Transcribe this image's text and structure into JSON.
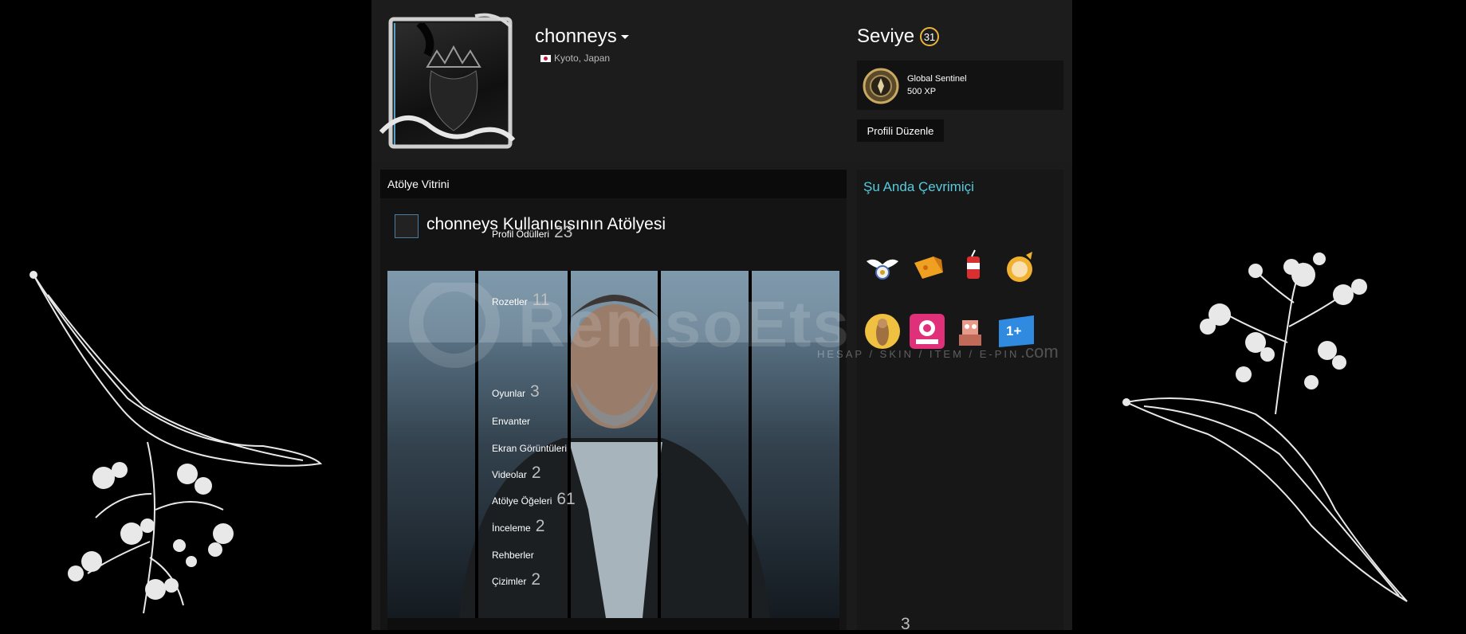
{
  "profile": {
    "persona_name": "chonneys",
    "location": "Kyoto, Japan",
    "level_label": "Seviye",
    "level_value": "31",
    "favorite_badge": {
      "name": "Global Sentinel",
      "xp": "500 XP"
    },
    "edit_button": "Profili Düzenle"
  },
  "showcase": {
    "header": "Atölye Vitrini",
    "workshop_title": "chonneys Kullanıcısının Atölyesi"
  },
  "status": {
    "online": "Şu Anda Çevrimiçi"
  },
  "sidebar": {
    "awards": {
      "label": "Profil Ödülleri",
      "count": "23"
    },
    "badges": {
      "label": "Rozetler",
      "count": "11",
      "extra_badge": "1+"
    },
    "items": [
      {
        "label": "Oyunlar",
        "count": "3"
      },
      {
        "label": "Envanter",
        "count": ""
      },
      {
        "label": "Ekran Görüntüleri",
        "count": ""
      },
      {
        "label": "Videolar",
        "count": "2"
      },
      {
        "label": "Atölye Öğeleri",
        "count": "61"
      },
      {
        "label": "İnceleme",
        "count": "2"
      },
      {
        "label": "Rehberler",
        "count": ""
      },
      {
        "label": "Çizimler",
        "count": "2"
      }
    ],
    "partial_count": "3"
  },
  "watermark": {
    "brand": "RemsoEts",
    "tagline": "HESAP / SKIN / ITEM / E-PIN",
    "suffix": ".com"
  },
  "colors": {
    "online": "#57cbde",
    "level_ring": "#e8b53c",
    "page_bg": "#000000",
    "profile_bg": "#1b1b1b"
  }
}
